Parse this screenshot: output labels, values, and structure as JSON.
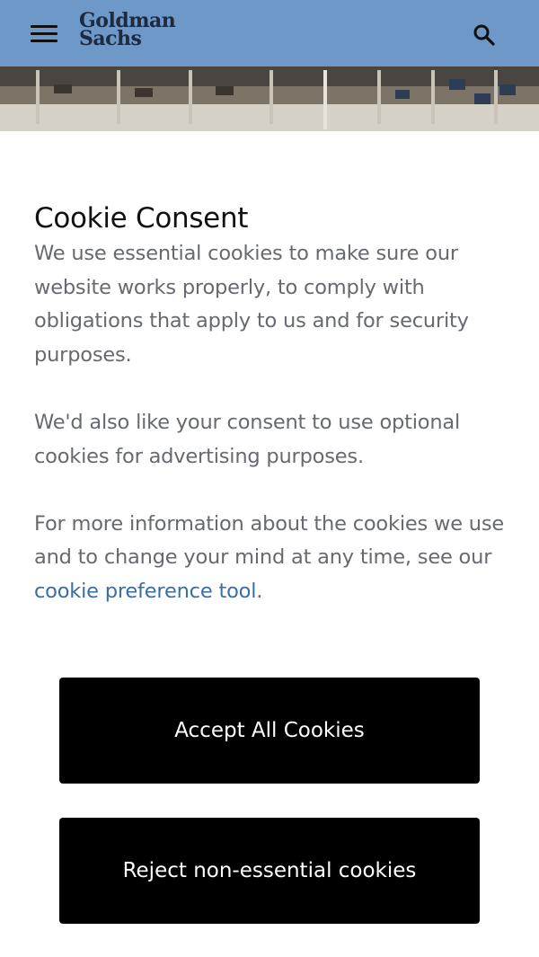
{
  "header": {
    "logo_line1": "Goldman",
    "logo_line2": "Sachs",
    "background": "#6e98c8"
  },
  "consent": {
    "title": "Cookie Consent",
    "paragraph1": "We use essential cookies to make sure our website works properly, to comply with obligations that apply to us and for security purposes.",
    "paragraph2": "We'd also like your consent to use optional cookies for advertising purposes.",
    "paragraph3_prefix": "For more information about the cookies we use and to change your mind at any time, see our ",
    "link_text": "cookie preference tool",
    "paragraph3_suffix": "."
  },
  "buttons": {
    "accept": "Accept All Cookies",
    "reject": "Reject non-essential cookies"
  },
  "icons": {
    "menu": "hamburger-menu-icon",
    "search": "search-icon"
  },
  "colors": {
    "link": "#3a6ea5",
    "button_bg": "#000000",
    "body_text": "#666a70"
  }
}
